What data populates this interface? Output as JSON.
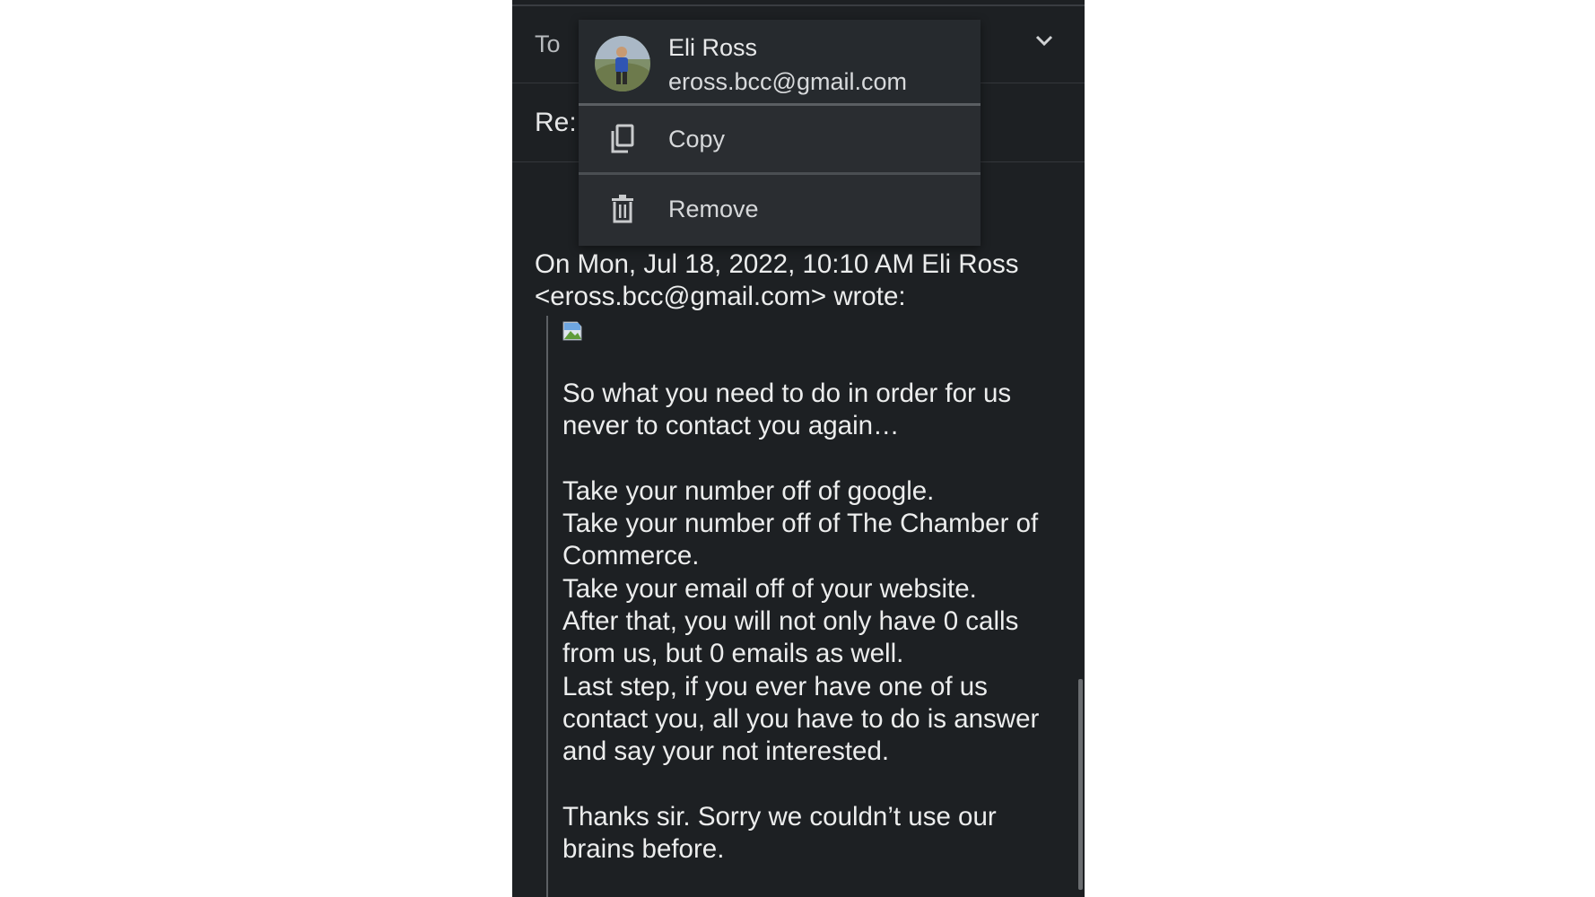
{
  "compose": {
    "to_label": "To",
    "subject_prefix": "Re:"
  },
  "recipient_menu": {
    "name": "Eli Ross",
    "email": "eross.bcc@gmail.com",
    "items": [
      {
        "label": "Copy",
        "icon": "copy-icon"
      },
      {
        "label": "Remove",
        "icon": "trash-icon"
      }
    ]
  },
  "quoted": {
    "header_line1": "On Mon, Jul 18, 2022, 10:10 AM Eli Ross",
    "header_line2": "<eross.bcc@gmail.com> wrote:",
    "paragraphs": [
      "So what you need to do in order for us never to contact you again…",
      "",
      "Take your number off of google.",
      "Take your number off of The Chamber of Commerce.",
      "Take your email off of your website.",
      "After that, you will not only have 0 calls from us, but 0 emails as well.",
      "Last step, if you ever have one of us contact you, all you have to do is answer and say your not interested.",
      "",
      "Thanks sir. Sorry we couldn’t use our brains before."
    ]
  },
  "colors": {
    "background": "#1d2023",
    "menu": "#2a2d31",
    "text": "#eceded"
  }
}
